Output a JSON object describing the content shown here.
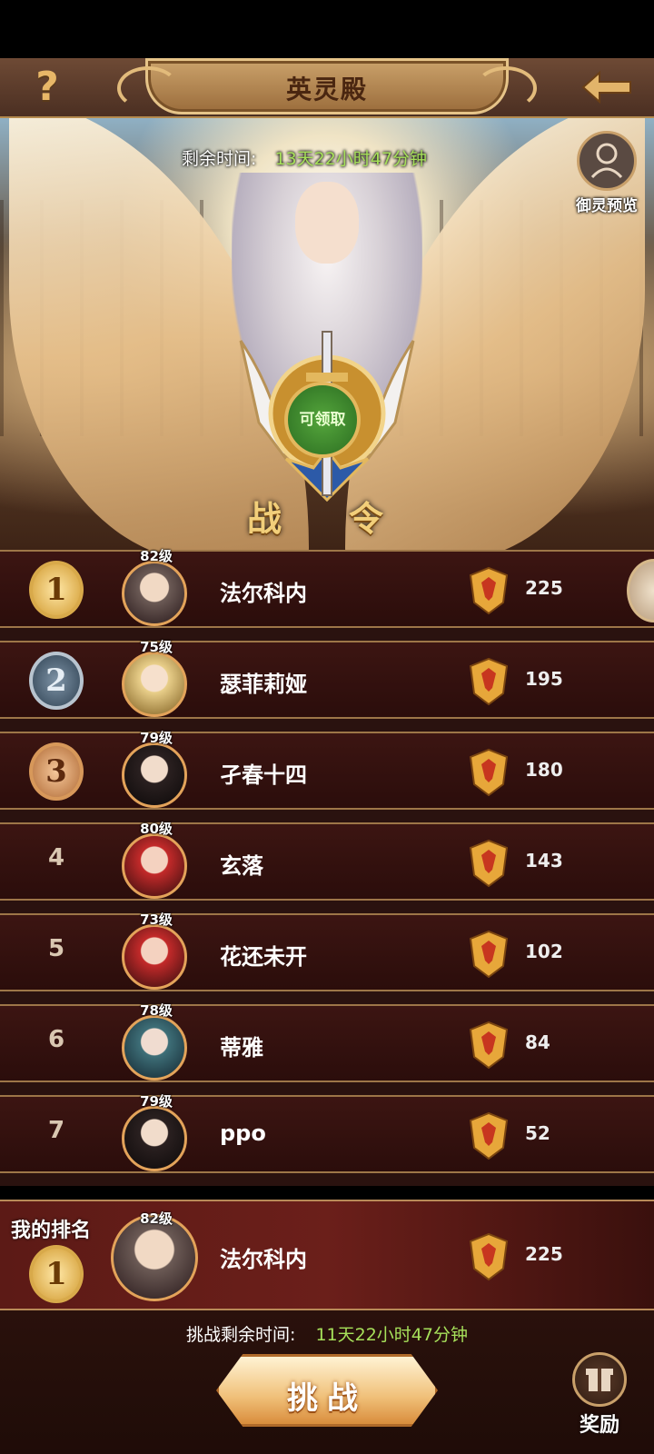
{
  "header": {
    "title": "英灵殿",
    "help_label": "?"
  },
  "banner": {
    "timer_label": "剩余时间:",
    "timer_value": "13天22小时47分钟",
    "preview_label": "御灵预览",
    "pass_claim_label": "可领取",
    "pass_char_1": "战",
    "pass_char_2": "令"
  },
  "rankings": [
    {
      "rank": "1",
      "level": "82级",
      "name": "法尔科内",
      "score": "225"
    },
    {
      "rank": "2",
      "level": "75级",
      "name": "瑟菲莉娅",
      "score": "195"
    },
    {
      "rank": "3",
      "level": "79级",
      "name": "孑春十四",
      "score": "180"
    },
    {
      "rank": "4",
      "level": "80级",
      "name": "玄落",
      "score": "143"
    },
    {
      "rank": "5",
      "level": "73级",
      "name": "花还未开",
      "score": "102"
    },
    {
      "rank": "6",
      "level": "78级",
      "name": "蒂雅",
      "score": "84"
    },
    {
      "rank": "7",
      "level": "79级",
      "name": "ppo",
      "score": "52"
    }
  ],
  "my_rank": {
    "label": "我的排名",
    "rank": "1",
    "level": "82级",
    "name": "法尔科内",
    "score": "225"
  },
  "bottom": {
    "challenge_timer_label": "挑战剩余时间:",
    "challenge_timer_value": "11天22小时47分钟",
    "challenge_button": "挑战",
    "reward_label": "奖励"
  },
  "colors": {
    "accent_gold": "#d8a94a",
    "timer_green": "#a6e05a",
    "row_bg": "#2b0d0b"
  }
}
